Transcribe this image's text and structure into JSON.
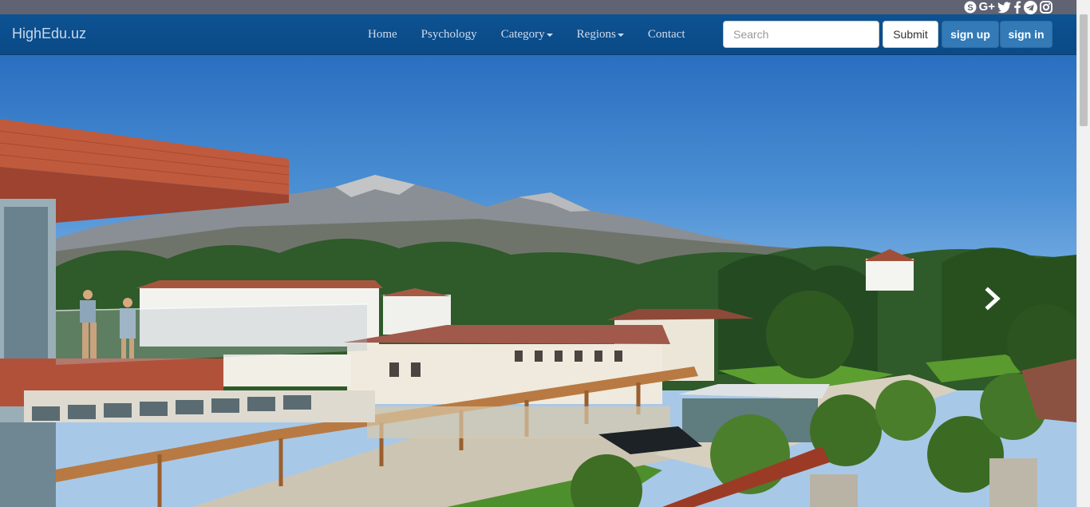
{
  "site": {
    "brand": "HighEdu.uz"
  },
  "social": [
    {
      "name": "skype-icon"
    },
    {
      "name": "google-plus-icon",
      "text": "G+"
    },
    {
      "name": "twitter-icon"
    },
    {
      "name": "facebook-icon"
    },
    {
      "name": "telegram-icon"
    },
    {
      "name": "instagram-icon"
    }
  ],
  "nav": {
    "home": "Home",
    "psychology": "Psychology",
    "category": "Category",
    "regions": "Regions",
    "contact": "Contact"
  },
  "search": {
    "placeholder": "Search",
    "value": ""
  },
  "buttons": {
    "submit": "Submit",
    "signup": "sign up",
    "signin": "sign in"
  },
  "carousel": {
    "next_icon": "chevron-right-icon"
  },
  "colors": {
    "navbar": "#0d5292",
    "topbar": "#5f6372",
    "primary_button": "#337ab7"
  }
}
